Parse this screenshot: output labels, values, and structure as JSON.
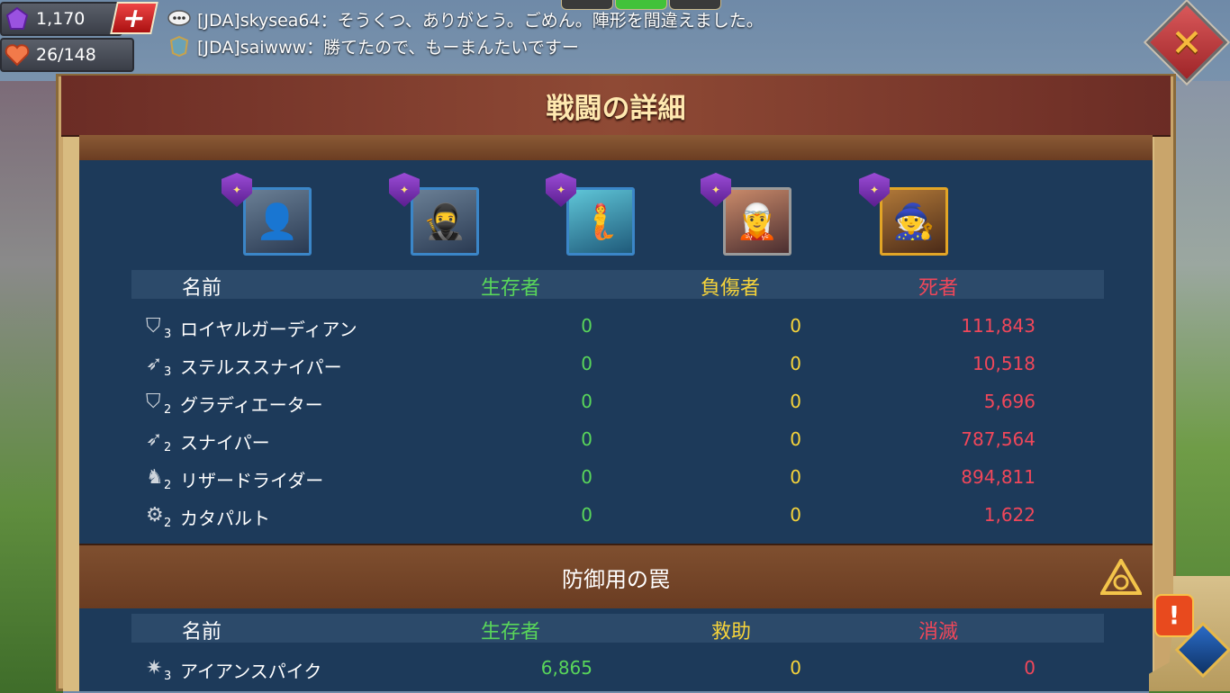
{
  "hud": {
    "gems": "1,170",
    "stamina": "26/148",
    "plus_label": "+"
  },
  "chat": [
    {
      "text": "[JDA]skysea64：そうくつ、ありがとう。ごめん。陣形を間違えました。"
    },
    {
      "text": "[JDA]saiwww：勝てたので、もーまんたいですー"
    }
  ],
  "close_label": "✕",
  "panel": {
    "title": "戦闘の詳細"
  },
  "heroes": [
    {
      "icon": "👤",
      "frame": "blue"
    },
    {
      "icon": "🥷",
      "frame": "blue"
    },
    {
      "icon": "🧜",
      "frame": "teal"
    },
    {
      "icon": "🧝",
      "frame": "silver"
    },
    {
      "icon": "🧙",
      "frame": "gold"
    }
  ],
  "troops": {
    "headers": {
      "name": "名前",
      "survivors": "生存者",
      "wounded": "負傷者",
      "dead": "死者"
    },
    "rows": [
      {
        "icon": "shield-icon",
        "tier": "3",
        "name": "ロイヤルガーディアン",
        "survivors": "0",
        "wounded": "0",
        "dead": "111,843"
      },
      {
        "icon": "bow-icon",
        "tier": "3",
        "name": "ステルススナイパー",
        "survivors": "0",
        "wounded": "0",
        "dead": "10,518"
      },
      {
        "icon": "shield-icon",
        "tier": "2",
        "name": "グラディエーター",
        "survivors": "0",
        "wounded": "0",
        "dead": "5,696"
      },
      {
        "icon": "bow-icon",
        "tier": "2",
        "name": "スナイパー",
        "survivors": "0",
        "wounded": "0",
        "dead": "787,564"
      },
      {
        "icon": "horse-icon",
        "tier": "2",
        "name": "リザードライダー",
        "survivors": "0",
        "wounded": "0",
        "dead": "894,811"
      },
      {
        "icon": "catapult-icon",
        "tier": "2",
        "name": "カタパルト",
        "survivors": "0",
        "wounded": "0",
        "dead": "1,622"
      }
    ]
  },
  "traps": {
    "title": "防御用の罠",
    "headers": {
      "name": "名前",
      "survivors": "生存者",
      "rescued": "救助",
      "destroyed": "消滅"
    },
    "rows": [
      {
        "icon": "spike-icon",
        "tier": "3",
        "name": "アイアンスパイク",
        "survivors": "6,865",
        "rescued": "0",
        "destroyed": "0"
      }
    ]
  },
  "alert_label": "!"
}
